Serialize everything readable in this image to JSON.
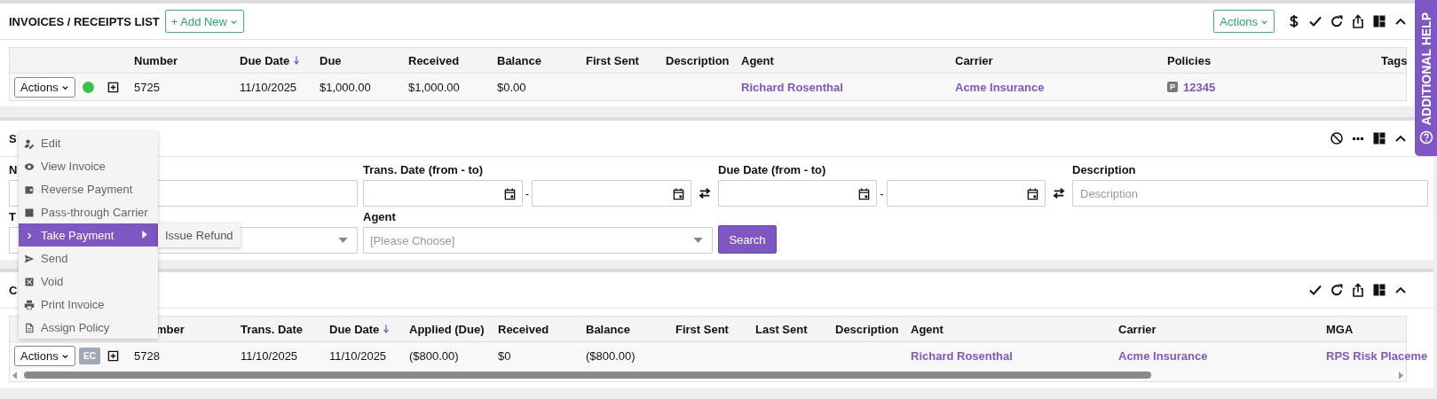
{
  "help_tab": {
    "label": "ADDITIONAL HELP"
  },
  "invoices": {
    "title": "INVOICES / RECEIPTS LIST",
    "add_button": "+ Add New",
    "actions_button": "Actions",
    "columns": [
      {
        "label": "Number",
        "sorted": false
      },
      {
        "label": "Due Date",
        "sorted": true
      },
      {
        "label": "Due",
        "sorted": false
      },
      {
        "label": "Received",
        "sorted": false
      },
      {
        "label": "Balance",
        "sorted": false
      },
      {
        "label": "First Sent",
        "sorted": false
      },
      {
        "label": "Description",
        "sorted": false
      },
      {
        "label": "Agent",
        "sorted": false
      },
      {
        "label": "Carrier",
        "sorted": false
      },
      {
        "label": "Policies",
        "sorted": false
      },
      {
        "label": "Tags",
        "sorted": false
      }
    ],
    "rows": [
      {
        "actions": "Actions",
        "status": {
          "kind": "dot",
          "color": "#3cc24a"
        },
        "cells": [
          {
            "kind": "text",
            "text": "5725"
          },
          {
            "kind": "text",
            "text": "11/10/2025"
          },
          {
            "kind": "text",
            "text": "$1,000.00"
          },
          {
            "kind": "text",
            "text": "$1,000.00"
          },
          {
            "kind": "text",
            "text": "$0.00"
          },
          {
            "kind": "blank"
          },
          {
            "kind": "blank"
          },
          {
            "kind": "link",
            "text": "Richard Rosenthal"
          },
          {
            "kind": "link",
            "text": "Acme Insurance"
          },
          {
            "kind": "policy",
            "badge": "P",
            "text": "12345"
          },
          {
            "kind": "blank"
          }
        ]
      }
    ]
  },
  "search": {
    "title": "S",
    "search_button": "Search",
    "fields": [
      {
        "kind": "text",
        "label": "N"
      },
      {
        "kind": "date_range",
        "label": "Trans. Date (from - to)",
        "separator": "-"
      },
      {
        "kind": "date_range",
        "label": "Due Date (from - to)",
        "separator": "-"
      },
      {
        "kind": "text",
        "label": "Description",
        "placeholder": "Description"
      },
      {
        "kind": "select",
        "label": "T"
      },
      {
        "kind": "select",
        "label": "Agent",
        "placeholder": "[Please Choose]"
      }
    ]
  },
  "credits": {
    "title": "C",
    "columns": [
      {
        "label": "mber",
        "sorted": false,
        "covered": true
      },
      {
        "label": "Trans. Date",
        "sorted": false,
        "covered": false
      },
      {
        "label": "Due Date",
        "sorted": true,
        "covered": false
      },
      {
        "label": "Applied (Due)",
        "sorted": false,
        "covered": false
      },
      {
        "label": "Received",
        "sorted": false,
        "covered": false
      },
      {
        "label": "Balance",
        "sorted": false,
        "covered": false
      },
      {
        "label": "First Sent",
        "sorted": false,
        "covered": false
      },
      {
        "label": "Last Sent",
        "sorted": false,
        "covered": false
      },
      {
        "label": "Description",
        "sorted": false,
        "covered": false
      },
      {
        "label": "Agent",
        "sorted": false,
        "covered": false
      },
      {
        "label": "Carrier",
        "sorted": false,
        "covered": false
      },
      {
        "label": "MGA",
        "sorted": false,
        "covered": false
      }
    ],
    "rows": [
      {
        "actions": "Actions",
        "status": {
          "kind": "badge",
          "text": "EC"
        },
        "cells": [
          {
            "kind": "text",
            "text": "5728"
          },
          {
            "kind": "text",
            "text": "11/10/2025"
          },
          {
            "kind": "text",
            "text": "11/10/2025"
          },
          {
            "kind": "text",
            "text": "($800.00)"
          },
          {
            "kind": "text",
            "text": "$0"
          },
          {
            "kind": "text",
            "text": "($800.00)"
          },
          {
            "kind": "blank"
          },
          {
            "kind": "blank"
          },
          {
            "kind": "blank"
          },
          {
            "kind": "link",
            "text": "Richard Rosenthal"
          },
          {
            "kind": "link",
            "text": "Acme Insurance"
          },
          {
            "kind": "link",
            "text": "RPS Risk Placeme"
          }
        ]
      }
    ]
  },
  "actions_menu": {
    "items": [
      {
        "label": "Edit",
        "selected": false
      },
      {
        "label": "View Invoice",
        "selected": false
      },
      {
        "label": "Reverse Payment",
        "selected": false
      },
      {
        "label": "Pass-through Carrier",
        "selected": false
      },
      {
        "label": "Take Payment",
        "selected": true
      },
      {
        "label": "Send",
        "selected": false
      },
      {
        "label": "Void",
        "selected": false
      },
      {
        "label": "Print Invoice",
        "selected": false
      },
      {
        "label": "Assign Policy",
        "selected": false
      }
    ],
    "submenu": [
      "Issue Refund"
    ]
  }
}
